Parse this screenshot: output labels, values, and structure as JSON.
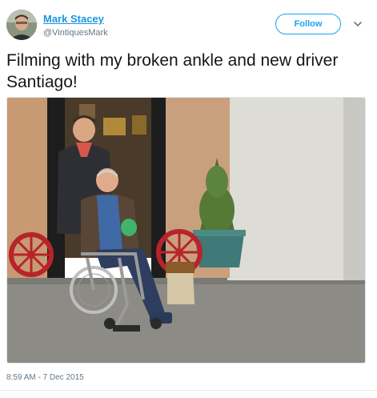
{
  "author": {
    "name": "Mark Stacey",
    "handle": "@VintiquesMark",
    "avatar_icon": "profile-photo"
  },
  "follow_button": {
    "label": "Follow"
  },
  "menu": {
    "icon": "chevron-down-icon"
  },
  "tweet": {
    "text": "Filming with my broken ankle and new driver Santiago!",
    "timestamp": "8:59 AM - 7 Dec 2015"
  },
  "media": {
    "description_icon": "photo",
    "colors": {
      "wall": "#dcdcd8",
      "door": "#c8a07a",
      "ground": "#8c8a84",
      "wheel": "#b8242a"
    }
  },
  "colors": {
    "link": "#1b95e0",
    "accent": "#1da1f2",
    "muted": "#657786",
    "text": "#14171a"
  }
}
